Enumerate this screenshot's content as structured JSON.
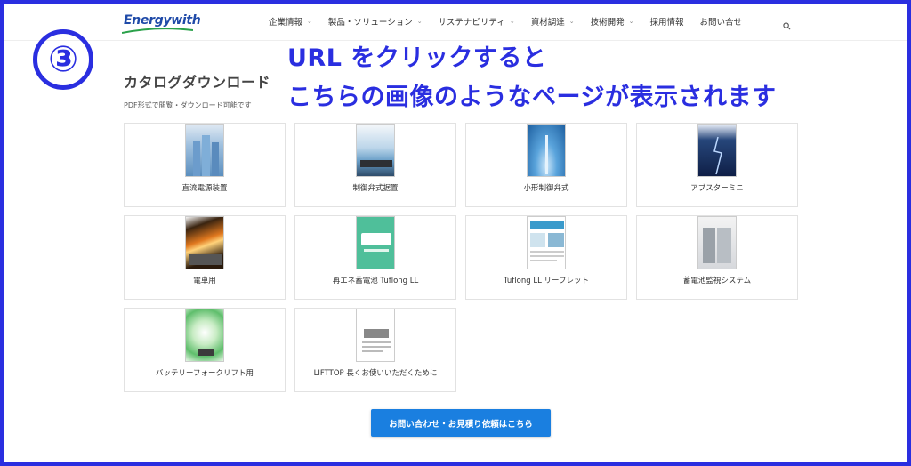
{
  "header": {
    "logo_text": "Energywith",
    "nav": [
      {
        "label": "企業情報",
        "dropdown": true
      },
      {
        "label": "製品・ソリューション",
        "dropdown": true
      },
      {
        "label": "サステナビリティ",
        "dropdown": true
      },
      {
        "label": "資材調達",
        "dropdown": true
      },
      {
        "label": "技術開発",
        "dropdown": true
      },
      {
        "label": "採用情報",
        "dropdown": false
      },
      {
        "label": "お問い合せ",
        "dropdown": false
      }
    ],
    "search_icon": "search-icon"
  },
  "annotation": {
    "step": "③",
    "line1": "URL をクリックすると",
    "line2": "こちらの画像のようなページが表示されます",
    "color": "#2a2ee0"
  },
  "page": {
    "title": "カタログダウンロード",
    "subtitle": "PDF形式で閲覧・ダウンロード可能です"
  },
  "catalogs": [
    {
      "label": "直流電源装置",
      "theme": "buildings"
    },
    {
      "label": "制御弁式据置",
      "theme": "sky"
    },
    {
      "label": "小形制御弁式",
      "theme": "fountain"
    },
    {
      "label": "アブスターミニ",
      "theme": "lightning"
    },
    {
      "label": "電車用",
      "theme": "fire"
    },
    {
      "label": "再エネ蓄電池 Tuflong LL",
      "theme": "green"
    },
    {
      "label": "Tuflong LL リーフレット",
      "theme": "leaflet"
    },
    {
      "label": "蓄電池監視システム",
      "theme": "cabinet"
    },
    {
      "label": "バッテリーフォークリフト用",
      "theme": "leaf"
    },
    {
      "label": "LIFTTOP 長くお使いいただくために",
      "theme": "doc"
    }
  ],
  "cta": {
    "label": "お問い合わせ・お見積り依頼はこちら"
  }
}
